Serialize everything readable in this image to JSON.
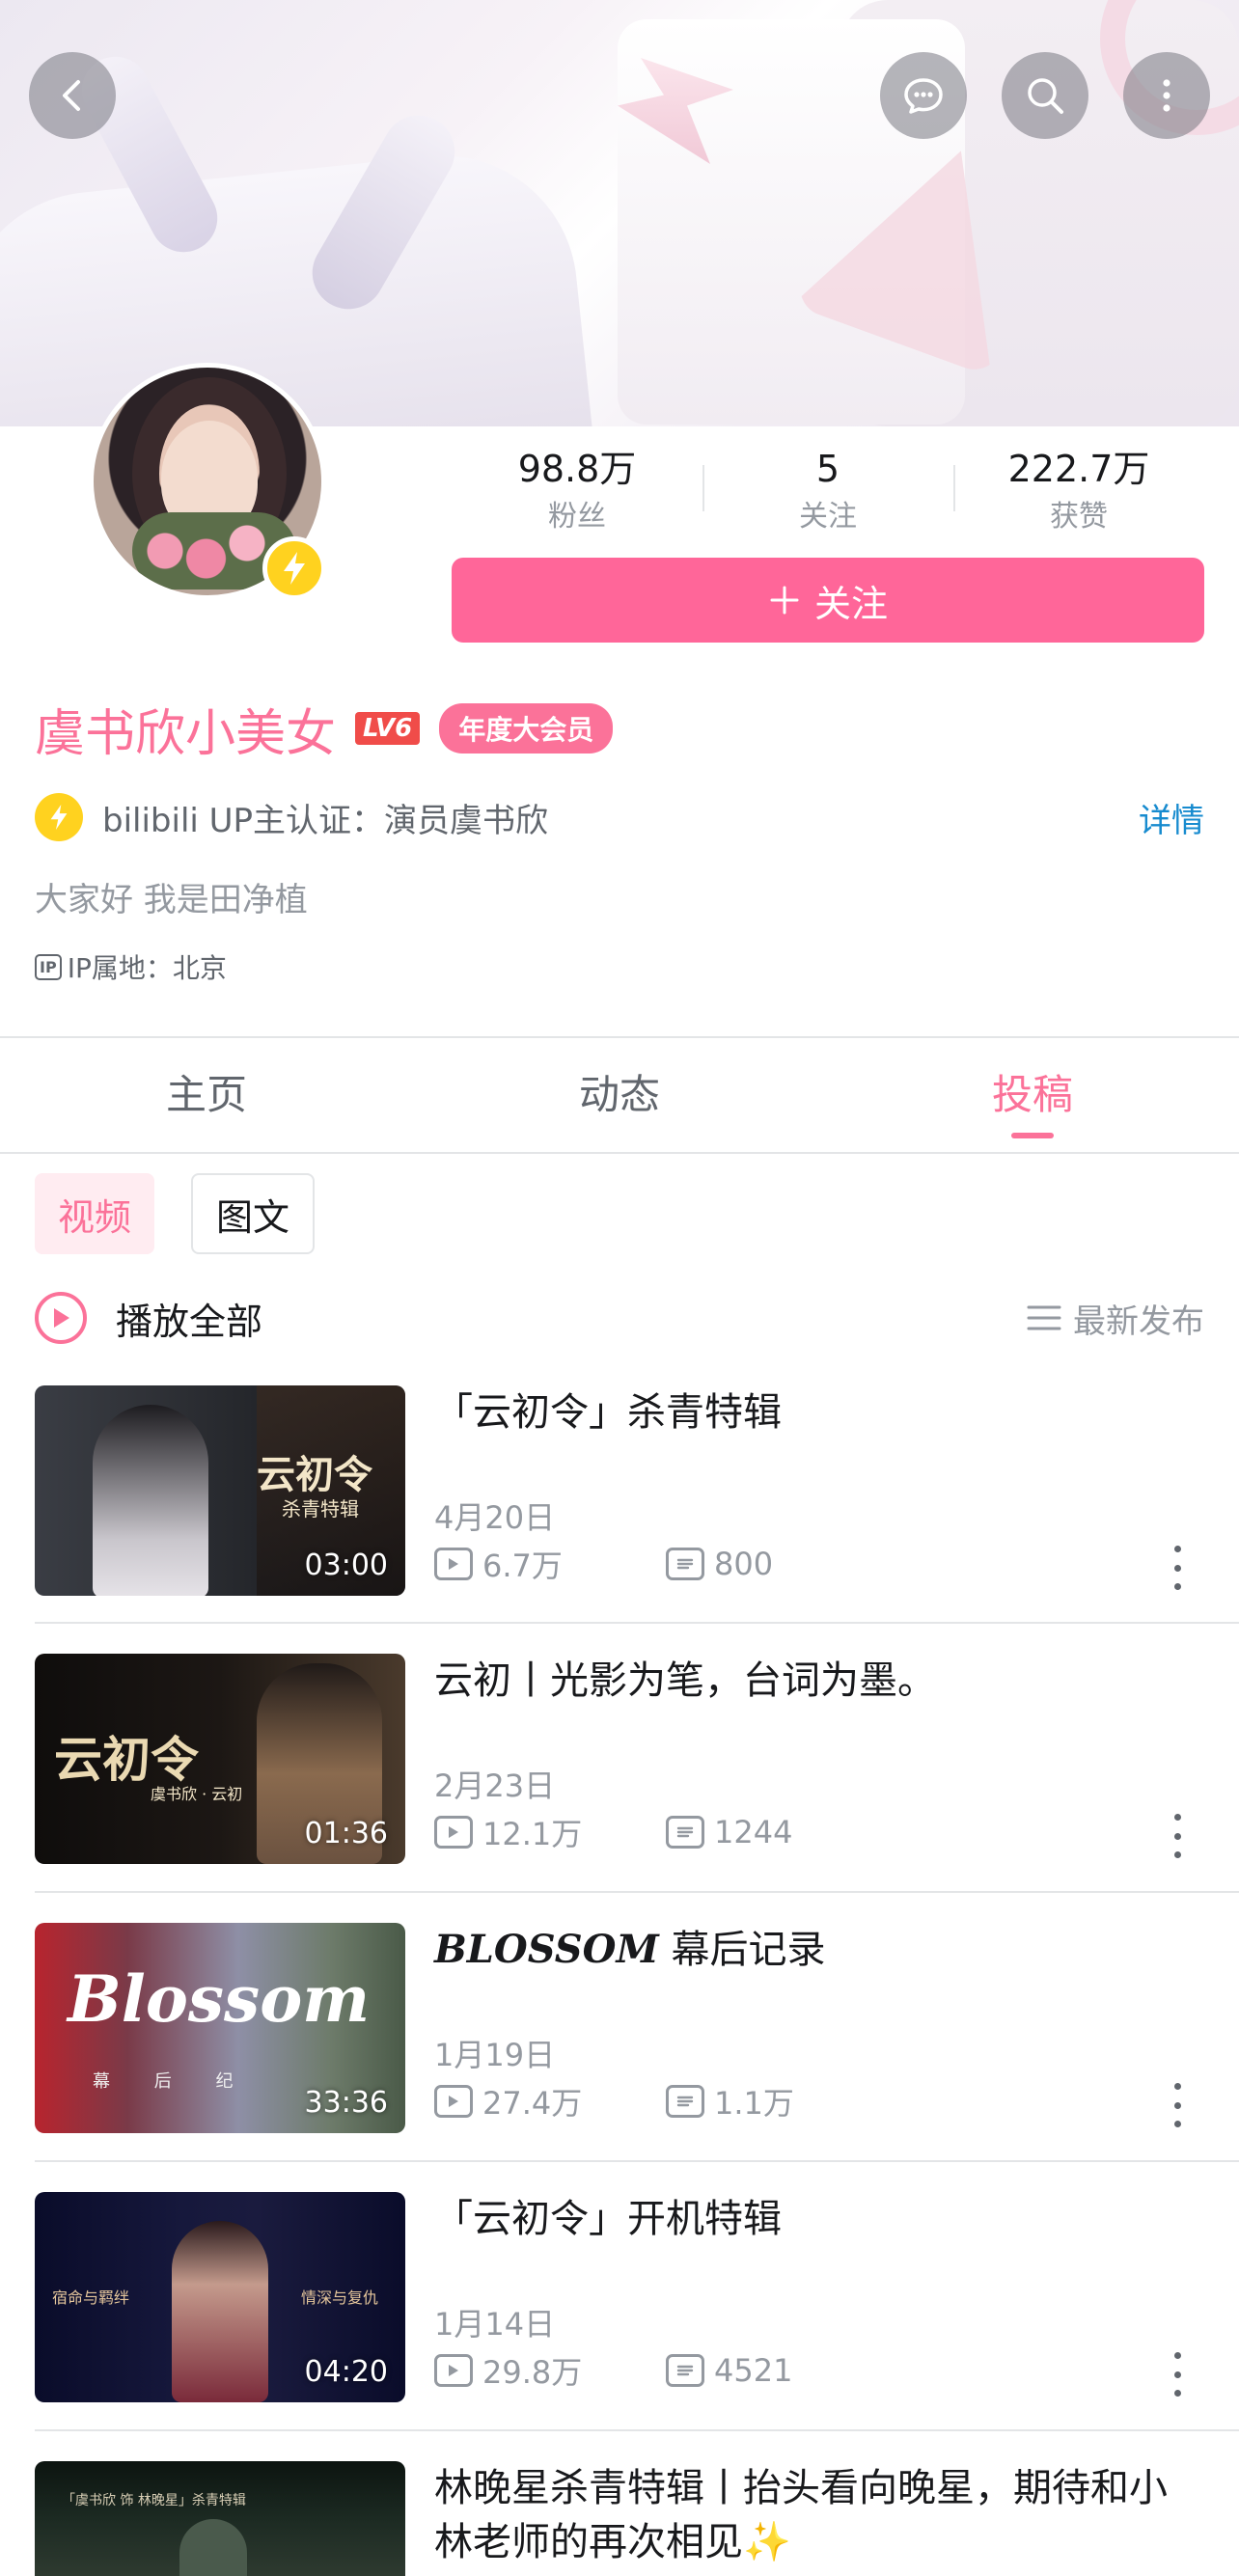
{
  "profile": {
    "stats": [
      {
        "value": "98.8万",
        "label": "粉丝"
      },
      {
        "value": "5",
        "label": "关注"
      },
      {
        "value": "222.7万",
        "label": "获赞"
      }
    ],
    "follow_label": "关注",
    "name": "虞书欣小美女",
    "level": "LV6",
    "vip_badge": "年度大会员",
    "certification": "bilibili UP主认证：演员虞书欣",
    "certification_link": "详情",
    "bio": "大家好 我是田净植",
    "ip_tag": "IP",
    "ip_location": "IP属地：北京"
  },
  "tabs": [
    {
      "label": "主页",
      "active": false
    },
    {
      "label": "动态",
      "active": false
    },
    {
      "label": "投稿",
      "active": true
    }
  ],
  "filters": {
    "video": "视频",
    "article": "图文"
  },
  "play_all": {
    "label": "播放全部",
    "sort": "最新发布"
  },
  "videos": [
    {
      "title": "「云初令」杀青特辑",
      "date": "4月20日",
      "views": "6.7万",
      "danmaku": "800",
      "duration": "03:00",
      "thumb_text": "云初令",
      "thumb_sub": "杀青特辑"
    },
    {
      "title": "云初丨光影为笔，台词为墨。",
      "date": "2月23日",
      "views": "12.1万",
      "danmaku": "1244",
      "duration": "01:36",
      "thumb_text": "云初令",
      "thumb_sub": "虞书欣 · 云初"
    },
    {
      "title": "BLOSSOM 幕后记录",
      "title_em": "BLOSSOM",
      "title_rest": " 幕后记录",
      "date": "1月19日",
      "views": "27.4万",
      "danmaku": "1.1万",
      "duration": "33:36",
      "thumb_text": "Blossom",
      "thumb_sub": "幕 后 纪"
    },
    {
      "title": "「云初令」开机特辑",
      "date": "1月14日",
      "views": "29.8万",
      "danmaku": "4521",
      "duration": "04:20",
      "thumb_text": "宿命与羁绊",
      "thumb_sub": "情深与复仇"
    },
    {
      "title": "林晚星杀青特辑丨抬头看向晚星，期待和小林老师的再次相见✨",
      "thumb_text": "「虞书欣 饰 林晚星」杀青特辑"
    }
  ],
  "colors": {
    "accent": "#fb7299",
    "follow_button": "#ff6699",
    "link": "#178bcf",
    "badge_yellow": "#ffd21f"
  },
  "icons": [
    "back-icon",
    "chat-icon",
    "search-icon",
    "more-vertical-icon",
    "lightning-icon",
    "play-circle-icon",
    "sort-list-icon",
    "play-count-icon",
    "danmaku-icon"
  ]
}
